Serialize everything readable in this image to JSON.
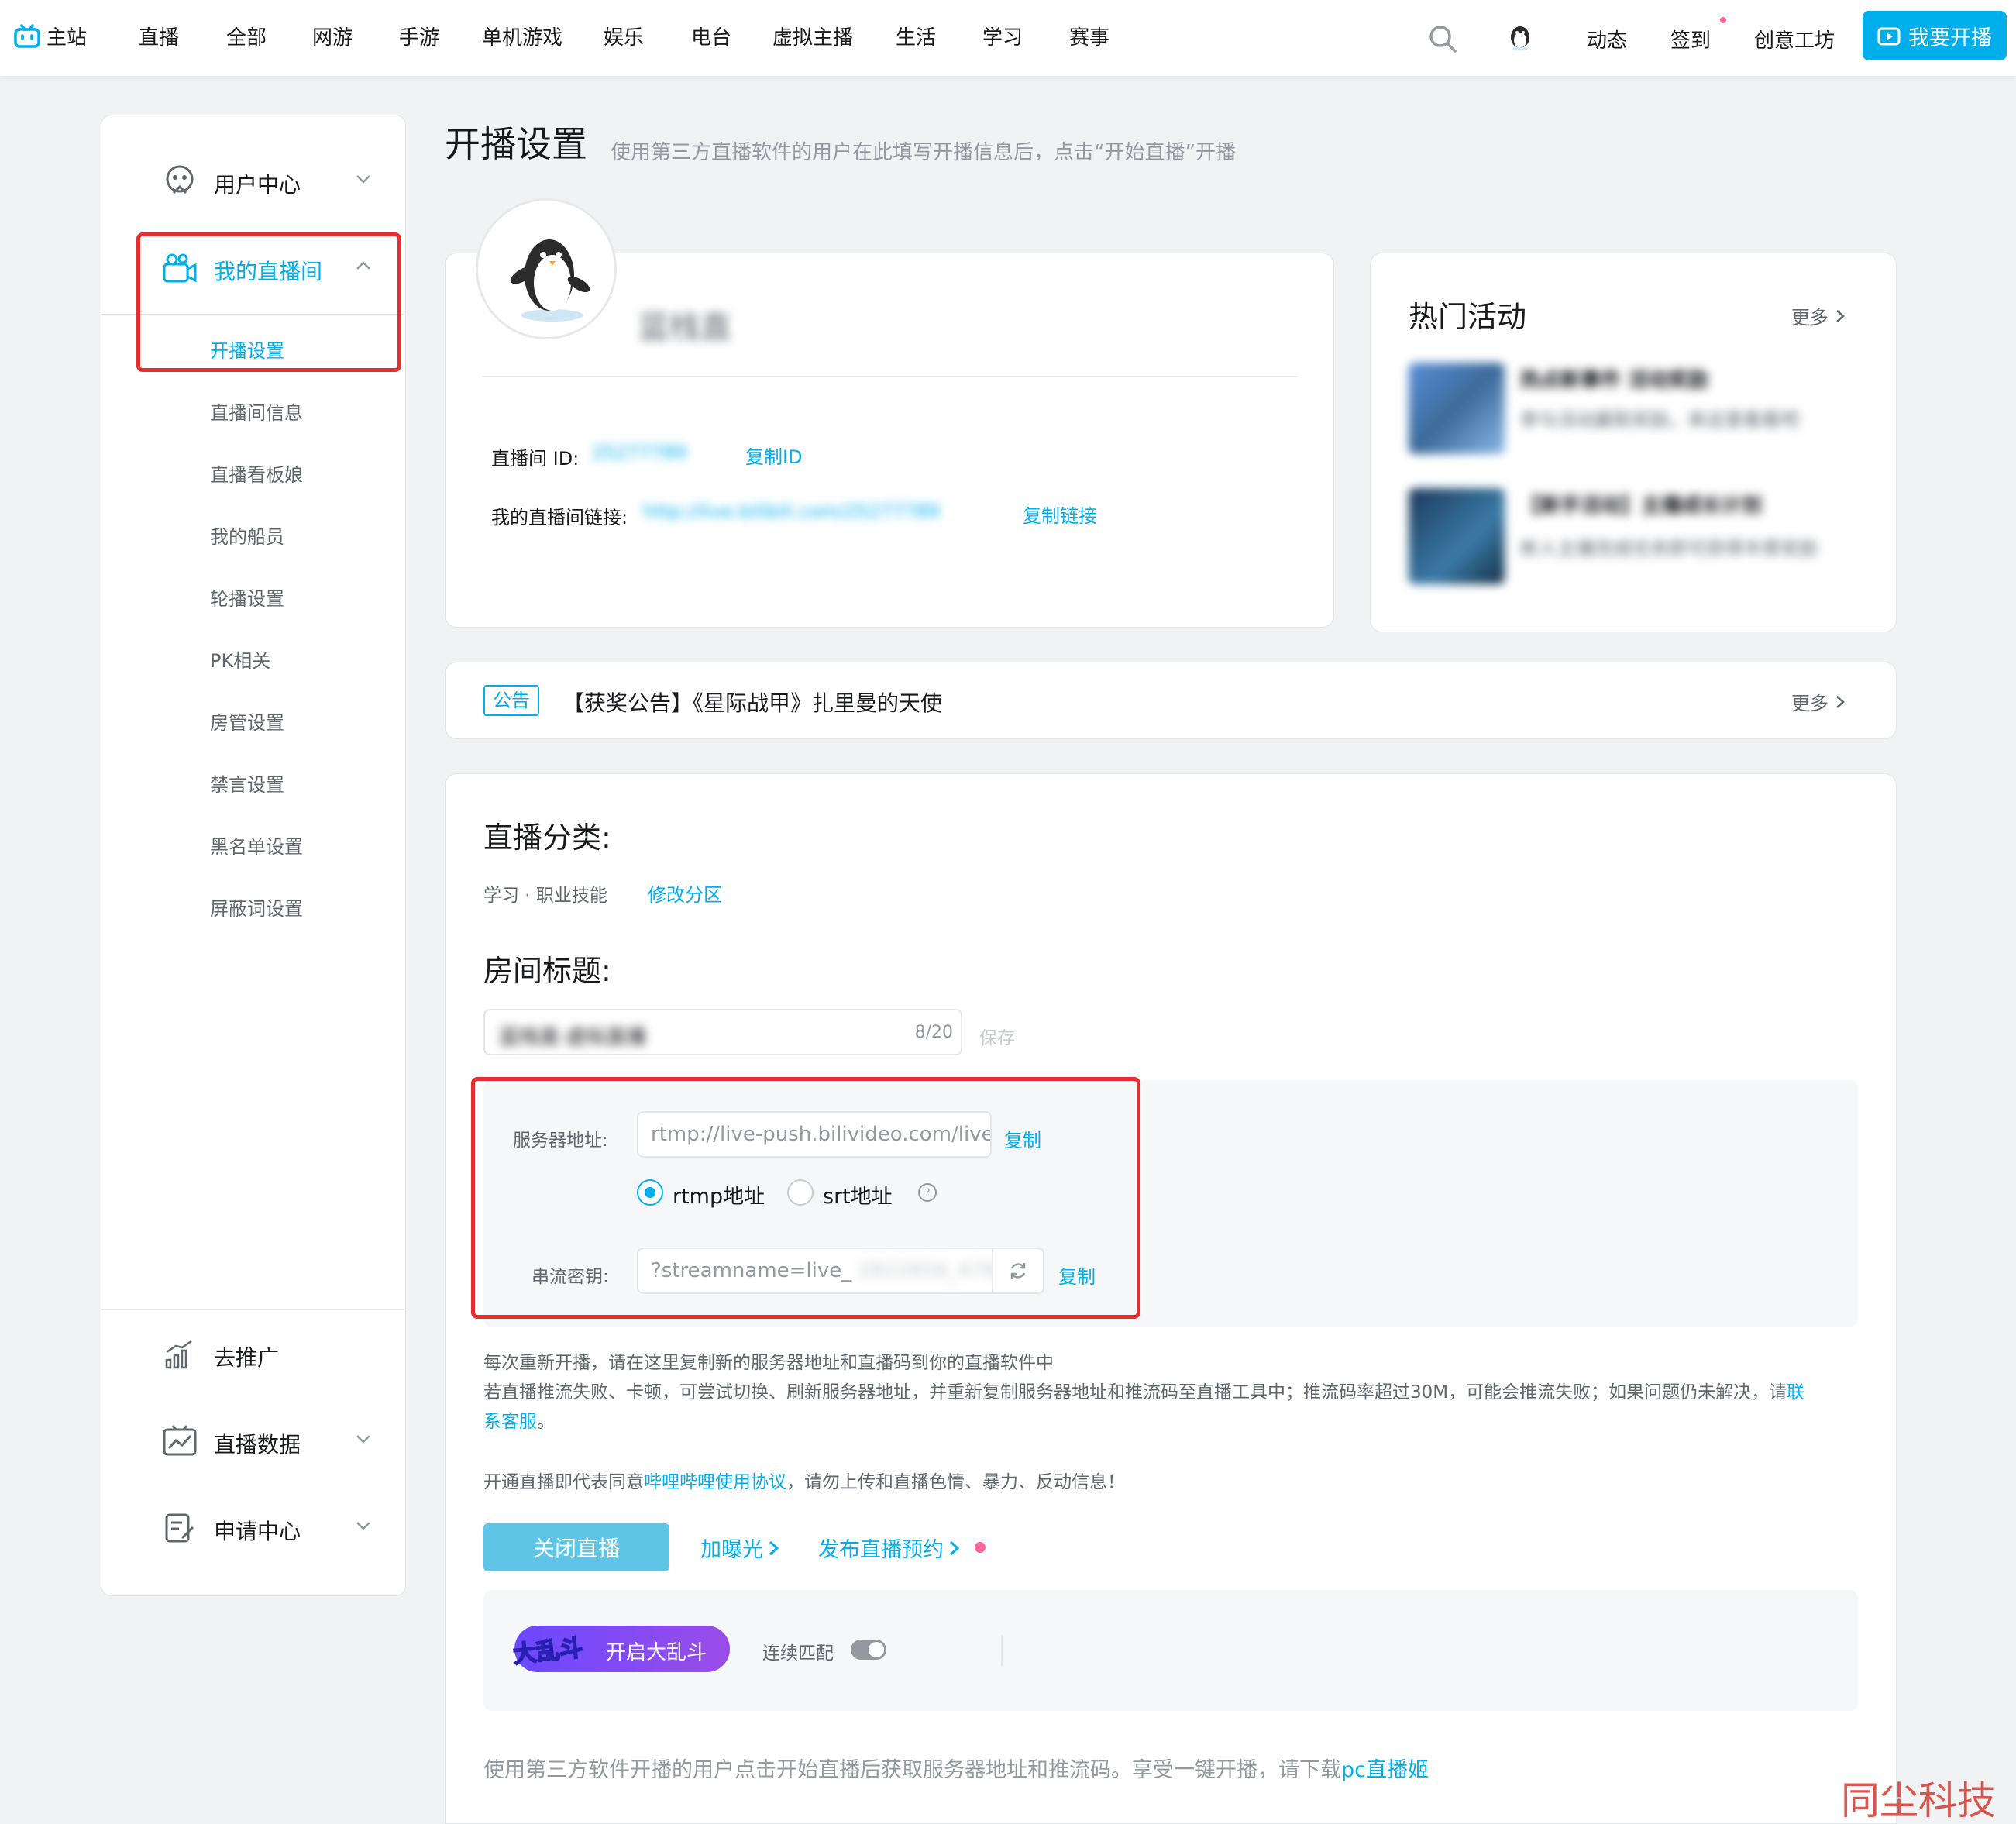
{
  "nav": {
    "home": "主站",
    "items": [
      "直播",
      "全部",
      "网游",
      "手游",
      "单机游戏",
      "娱乐",
      "电台",
      "虚拟主播",
      "生活",
      "学习",
      "赛事"
    ],
    "right": [
      "动态",
      "签到",
      "创意工坊"
    ],
    "go_live": "我要开播"
  },
  "sidebar": {
    "user_center": "用户中心",
    "my_room": "我的直播间",
    "sub_items": [
      "开播设置",
      "直播间信息",
      "直播看板娘",
      "我的船员",
      "轮播设置",
      "PK相关",
      "房管设置",
      "禁言设置",
      "黑名单设置",
      "屏蔽词设置"
    ],
    "promote": "去推广",
    "live_data": "直播数据",
    "apply_center": "申请中心"
  },
  "page": {
    "title": "开播设置",
    "subtitle": "使用第三方直播软件的用户在此填写开播信息后，点击“开始直播”开播"
  },
  "profile": {
    "username": "蓝栈直",
    "room_id_label": "直播间 ID:",
    "room_id": "25277789",
    "copy_id": "复制ID",
    "room_link_label": "我的直播间链接:",
    "room_link": "http://live.bilibili.com/25277789",
    "copy_link": "复制链接"
  },
  "hot": {
    "title": "热门活动",
    "more": "更多",
    "items": [
      {
        "title": "热点新事件 活动奖励",
        "desc": "参与活动赢取奖励，来这里看看吧"
      },
      {
        "title": "【新手活动】主播成长计划",
        "desc": "新人主播完成任务即可获得丰厚奖励"
      }
    ]
  },
  "notice": {
    "tag": "公告",
    "text": "【获奖公告】《星际战甲》扎里曼的天使",
    "more": "更多"
  },
  "live": {
    "category_title": "直播分类:",
    "category_value": "学习 · 职业技能",
    "edit_category": "修改分区",
    "room_title_label": "房间标题:",
    "room_title_value": "蓝栈直·虚拟直播",
    "title_count": "8/20",
    "save": "保存",
    "server_label": "服务器地址:",
    "server_value": "rtmp://live-push.bilivideo.com/live-bvc/",
    "copy": "复制",
    "rtmp": "rtmp地址",
    "srt": "srt地址",
    "key_label": "串流密钥:",
    "key_value": "?streamname=live_",
    "help_line1": "每次重新开播，请在这里复制新的服务器地址和直播码到你的直播软件中",
    "help_line2_a": "若直播推流失败、卡顿，可尝试切换、刷新服务器地址，并重新复制服务器地址和推流码至直播工具中；推流码率超过30M，可能会推流失败；如果问题仍未解决，请",
    "help_line2_link_a": "联",
    "help_line3_link": "系客服",
    "help_line3_end": "。",
    "agree_a": "开通直播即代表同意",
    "agree_link": "哔哩哔哩使用协议",
    "agree_b": "，请勿上传和直播色情、暴力、反动信息！",
    "stop_button": "关闭直播",
    "boost": "加曝光",
    "schedule": "发布直播预约",
    "brawl_logo": "大乱斗",
    "brawl_button": "开启大乱斗",
    "continuous_match": "连续匹配",
    "footer_a": "使用第三方软件开播的用户点击开始直播后获取服务器地址和推流码。享受一键开播，请下载",
    "footer_link": "pc直播姬"
  },
  "watermark": "同尘科技",
  "colors": {
    "accent": "#00aeec",
    "highlight_box": "#e52f2f",
    "pink": "#ff6699"
  }
}
